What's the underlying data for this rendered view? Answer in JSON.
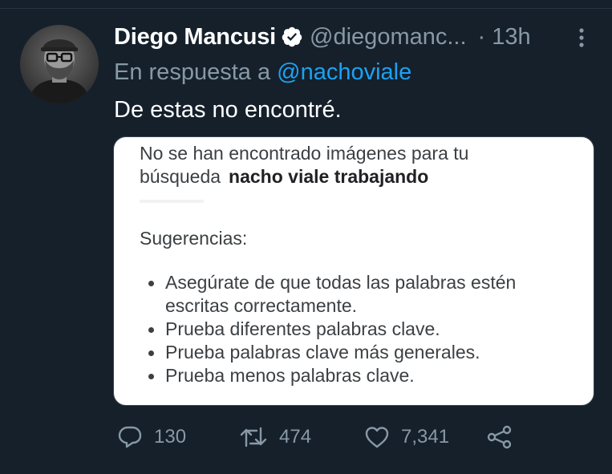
{
  "tweet": {
    "author_name": "Diego Mancusi",
    "author_handle": "@diegomanc...",
    "separator": "·",
    "timestamp": "13h",
    "reply_prefix": "En respuesta a",
    "reply_to": "@nachoviale",
    "text": "De estas no encontré."
  },
  "media": {
    "no_results_line1": "No se han encontrado imágenes para tu",
    "no_results_prefix": "búsqueda",
    "query": "nacho viale trabajando",
    "suggestions_title": "Sugerencias:",
    "suggestions": [
      {
        "line1": "Asegúrate de que todas las palabras estén",
        "line2": "escritas correctamente."
      },
      {
        "line1": "Prueba diferentes palabras clave.",
        "line2": ""
      },
      {
        "line1": "Prueba palabras clave más generales.",
        "line2": ""
      },
      {
        "line1": "Prueba menos palabras clave.",
        "line2": ""
      }
    ]
  },
  "actions": {
    "replies": "130",
    "retweets": "474",
    "likes": "7,341"
  },
  "icons": {
    "verified": "verified-badge-icon",
    "more": "more-vertical-icon",
    "reply": "reply-icon",
    "retweet": "retweet-icon",
    "like": "heart-icon",
    "share": "share-icon"
  },
  "colors": {
    "background": "#15202b",
    "secondary_text": "#8899a6",
    "link": "#1da1f2",
    "primary_text": "#ffffff"
  }
}
